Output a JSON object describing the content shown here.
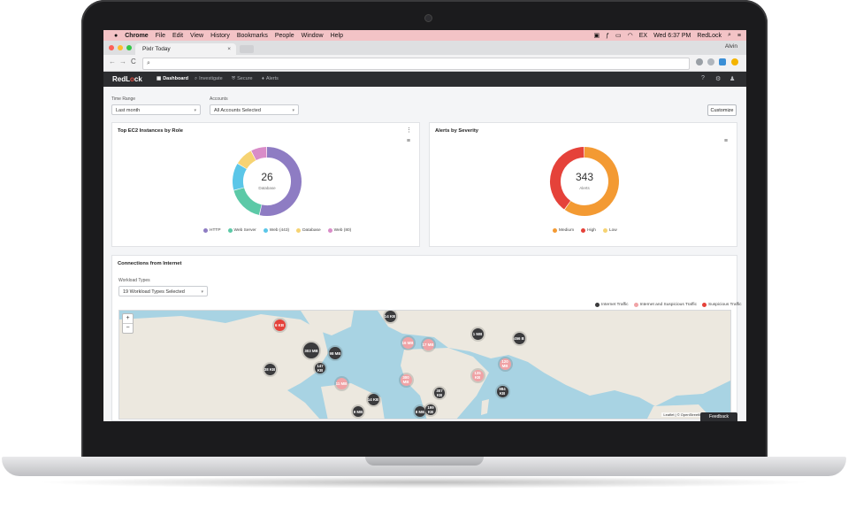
{
  "menubar": {
    "apple": "",
    "items": [
      "Chrome",
      "File",
      "Edit",
      "View",
      "History",
      "Bookmarks",
      "People",
      "Window",
      "Help"
    ],
    "clock": "Wed 6:37 PM",
    "app_name": "RedLock",
    "battery": "EX"
  },
  "browser": {
    "tab_title": "Pixlr Today",
    "tab_close": "×",
    "profile_name": "Alvin",
    "address_value": "",
    "back": "←",
    "forward": "→",
    "reload": "C"
  },
  "app": {
    "logo_prefix": "RedL",
    "logo_o": "o",
    "logo_suffix": "ck",
    "nav": [
      {
        "label": "Dashboard",
        "icon": "grid-icon",
        "glyph": "▦"
      },
      {
        "label": "Investigate",
        "icon": "search-icon",
        "glyph": "⌕"
      },
      {
        "label": "Secure",
        "icon": "shield-icon",
        "glyph": "⛨"
      },
      {
        "label": "Alerts",
        "icon": "bell-icon",
        "glyph": "♦"
      }
    ]
  },
  "filters": {
    "time_range_label": "Time Range",
    "time_range_value": "Last month",
    "accounts_label": "Accounts",
    "accounts_value": "All Accounts Selected",
    "customize": "Customize"
  },
  "ec2_card": {
    "title": "Top EC2 Instances by Role",
    "center_value": "26",
    "center_label": "Database",
    "legend": [
      {
        "name": "HTTP",
        "color": "#8e7cc3"
      },
      {
        "name": "Web Server",
        "color": "#5cc9a7"
      },
      {
        "name": "Web (443)",
        "color": "#5bc6e8"
      },
      {
        "name": "Database",
        "color": "#f6d372"
      },
      {
        "name": "Web (80)",
        "color": "#d98cc8"
      }
    ]
  },
  "alerts_card": {
    "title": "Alerts by Severity",
    "center_value": "343",
    "center_label": "Alerts",
    "legend": [
      {
        "name": "Medium",
        "color": "#f39a33"
      },
      {
        "name": "High",
        "color": "#e5423a"
      },
      {
        "name": "Low",
        "color": "#f6d372"
      }
    ]
  },
  "connections": {
    "title": "Connections from Internet",
    "workload_label": "Workload Types",
    "workload_value": "19 Workload Types Selected",
    "legend": [
      {
        "name": "Internet Traffic",
        "color": "#3a3a3c"
      },
      {
        "name": "Internet and Suspicious Traffic",
        "color": "#f0a3a6"
      },
      {
        "name": "Suspicious Traffic",
        "color": "#e5423a"
      }
    ],
    "zoom_in": "+",
    "zoom_out": "−",
    "attribution": "Leaflet | © OpenStreetMap contributors",
    "bubbles": [
      {
        "label": "14 KB",
        "kind": "dark"
      },
      {
        "label": "6 KB",
        "kind": "red"
      },
      {
        "label": "303 MB",
        "kind": "dark"
      },
      {
        "label": "98 MB",
        "kind": "dark"
      },
      {
        "label": "147 KB",
        "kind": "dark"
      },
      {
        "label": "38 KB",
        "kind": "dark"
      },
      {
        "label": "11 MB",
        "kind": "pink"
      },
      {
        "label": "14 KB",
        "kind": "dark"
      },
      {
        "label": "9 MB",
        "kind": "dark"
      },
      {
        "label": "8 MB",
        "kind": "dark"
      },
      {
        "label": "16 MB",
        "kind": "pink"
      },
      {
        "label": "17 MB",
        "kind": "pink"
      },
      {
        "label": "1 MB",
        "kind": "dark"
      },
      {
        "label": "456 B",
        "kind": "dark"
      },
      {
        "label": "120 MB",
        "kind": "pink"
      },
      {
        "label": "135 KB",
        "kind": "pink"
      },
      {
        "label": "984 KB",
        "kind": "dark"
      },
      {
        "label": "307 KB",
        "kind": "dark"
      },
      {
        "label": "199 KB",
        "kind": "dark"
      },
      {
        "label": "300 MB",
        "kind": "pink"
      }
    ]
  },
  "feedback": "Feedback"
}
